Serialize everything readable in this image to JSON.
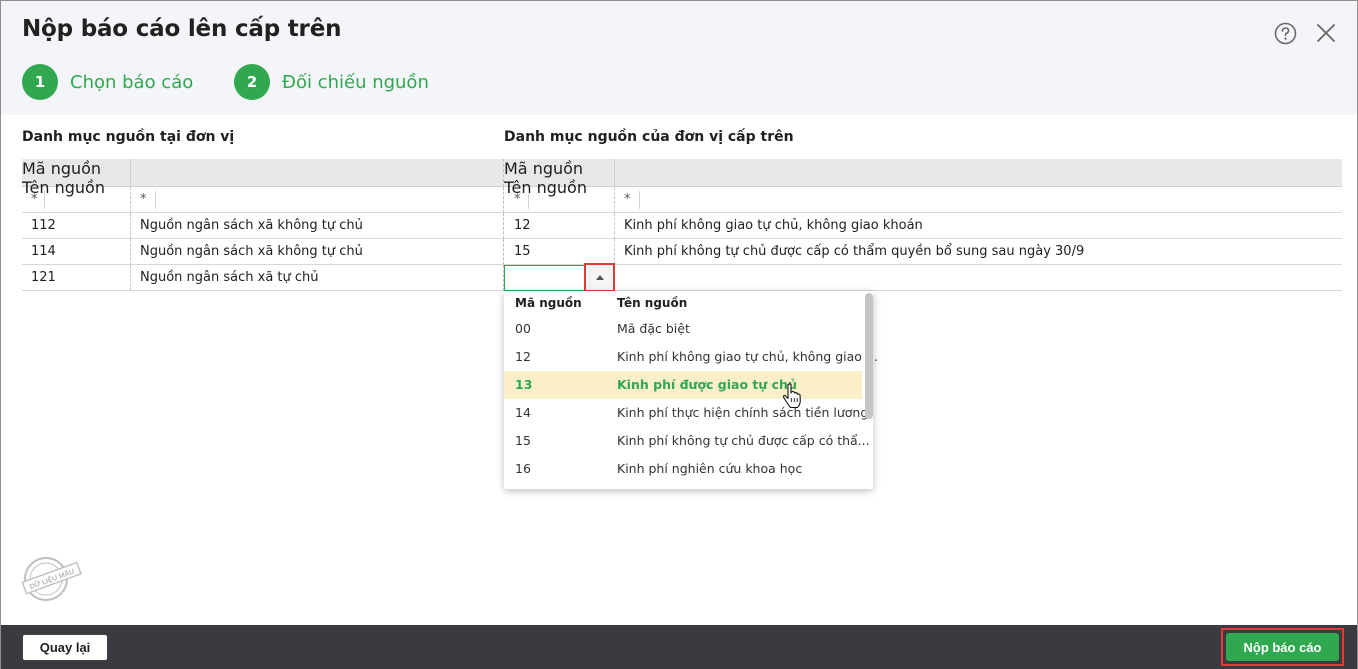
{
  "dialog": {
    "title": "Nộp báo cáo lên cấp trên",
    "steps": [
      {
        "number": "1",
        "label": "Chọn báo cáo"
      },
      {
        "number": "2",
        "label": "Đối chiếu nguồn"
      }
    ]
  },
  "left_panel": {
    "title": "Danh mục nguồn tại đơn vị",
    "columns": [
      "Mã nguồn",
      "Tên nguồn"
    ],
    "filter": [
      "*",
      "*"
    ],
    "rows": [
      {
        "code": "112",
        "name": "Nguồn ngân sách xã không tự chủ"
      },
      {
        "code": "114",
        "name": "Nguồn ngân sách xã không tự chủ"
      },
      {
        "code": "121",
        "name": "Nguồn ngân sách xã tự chủ"
      }
    ]
  },
  "right_panel": {
    "title": "Danh mục nguồn của đơn vị cấp trên",
    "columns": [
      "Mã nguồn",
      "Tên nguồn"
    ],
    "filter": [
      "*",
      "*"
    ],
    "rows": [
      {
        "code": "12",
        "name": "Kinh phí không giao tự chủ, không giao khoán"
      },
      {
        "code": "15",
        "name": "Kinh phí không tự chủ được cấp có thẩm quyền bổ sung sau ngày 30/9"
      },
      {
        "code": "",
        "name": ""
      }
    ]
  },
  "dropdown": {
    "columns": [
      "Mã nguồn",
      "Tên nguồn"
    ],
    "selected_index": 2,
    "items": [
      {
        "code": "00",
        "name": "Mã đặc biệt"
      },
      {
        "code": "12",
        "name": "Kinh phí không giao tự chủ, không giao ..."
      },
      {
        "code": "13",
        "name": "Kinh phí được giao tự chủ"
      },
      {
        "code": "14",
        "name": "Kinh phí thực hiện chính sách tiền lương"
      },
      {
        "code": "15",
        "name": "Kinh phí không tự chủ được cấp có thẩ..."
      },
      {
        "code": "16",
        "name": "Kinh phí nghiên cứu khoa học"
      }
    ]
  },
  "stamp": {
    "text": "DỮ LIỆU MẪU"
  },
  "footer": {
    "back_label": "Quay lại",
    "submit_label": "Nộp báo cáo"
  },
  "colors": {
    "accent": "#2fa84f",
    "highlight": "#e53935",
    "selected_row": "#faefc8",
    "footer": "#3a3b40"
  }
}
